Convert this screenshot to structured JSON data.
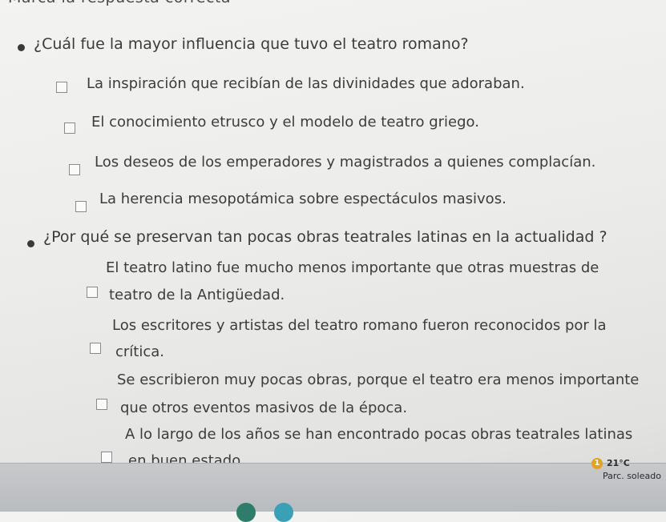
{
  "header": {
    "instruction": "Marca la respuesta correcta"
  },
  "questions": [
    {
      "text": "¿Cuál fue la mayor influencia que tuvo el teatro romano?",
      "options": [
        {
          "lines": [
            "La inspiración que recibían de las divinidades que adoraban."
          ]
        },
        {
          "lines": [
            "El conocimiento etrusco y el modelo de teatro griego."
          ]
        },
        {
          "lines": [
            "Los deseos de los emperadores y magistrados a quienes complacían."
          ]
        },
        {
          "lines": [
            "La herencia mesopotámica sobre espectáculos masivos."
          ]
        }
      ]
    },
    {
      "text": "¿Por qué se preservan tan pocas obras teatrales latinas en la actualidad ?",
      "options": [
        {
          "lines": [
            "El teatro latino fue mucho menos importante que otras muestras de",
            "teatro de la Antigüedad."
          ]
        },
        {
          "lines": [
            "Los escritores y artistas del teatro romano fueron reconocidos por la",
            "crítica."
          ]
        },
        {
          "lines": [
            "Se escribieron muy pocas obras, porque el teatro era menos importante",
            "que otros eventos masivos de la época."
          ]
        },
        {
          "lines": [
            "A lo largo de los años se  han encontrado pocas obras teatrales latinas",
            "en buen estado."
          ]
        }
      ]
    }
  ],
  "taskbar": {
    "weather_badge": "1",
    "temperature": "21°C",
    "condition": "Parc. soleado",
    "icon_colors": [
      "#2e7d6b",
      "#3aa0b5"
    ]
  }
}
